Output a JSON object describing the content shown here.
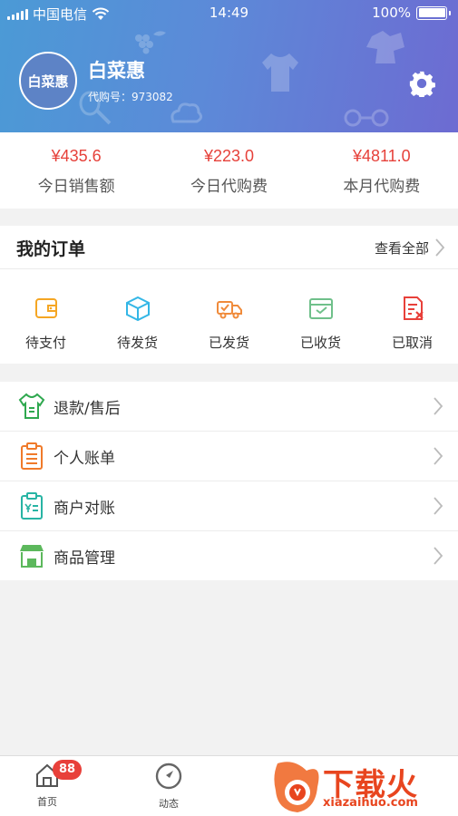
{
  "status_bar": {
    "carrier": "中国电信",
    "time": "14:49",
    "battery": "100%"
  },
  "profile": {
    "avatar_text": "白菜惠",
    "name": "白菜惠",
    "agent_id": "代购号：973082"
  },
  "stats": [
    {
      "value": "¥435.6",
      "label": "今日销售额"
    },
    {
      "value": "¥223.0",
      "label": "今日代购费"
    },
    {
      "value": "¥4811.0",
      "label": "本月代购费"
    }
  ],
  "orders": {
    "title": "我的订单",
    "view_all": "查看全部",
    "items": [
      {
        "label": "待支付",
        "icon": "wallet-icon",
        "color": "#f5a623"
      },
      {
        "label": "待发货",
        "icon": "package-icon",
        "color": "#33b6e6"
      },
      {
        "label": "已发货",
        "icon": "truck-icon",
        "color": "#f08b3b"
      },
      {
        "label": "已收货",
        "icon": "inbox-icon",
        "color": "#6fc08a"
      },
      {
        "label": "已取消",
        "icon": "cancel-doc-icon",
        "color": "#e8403a"
      }
    ]
  },
  "menu": [
    {
      "label": "退款/售后",
      "icon": "refund-shirt-icon",
      "color": "#2fa84f"
    },
    {
      "label": "个人账单",
      "icon": "clipboard-icon",
      "color": "#f07a2a"
    },
    {
      "label": "商户对账",
      "icon": "ledger-icon",
      "color": "#28b4a4"
    },
    {
      "label": "商品管理",
      "icon": "store-icon",
      "color": "#5cb85c"
    }
  ],
  "tabbar": {
    "tabs": [
      {
        "label": "首页",
        "icon": "home-icon",
        "badge": "88"
      },
      {
        "label": "动态",
        "icon": "compass-icon"
      }
    ]
  },
  "watermark": {
    "text": "下载火",
    "url": "xiazaihuo.com"
  },
  "colors": {
    "accent_red": "#e6413a",
    "header_start": "#4b9ad6",
    "header_end": "#6d6bd2"
  }
}
